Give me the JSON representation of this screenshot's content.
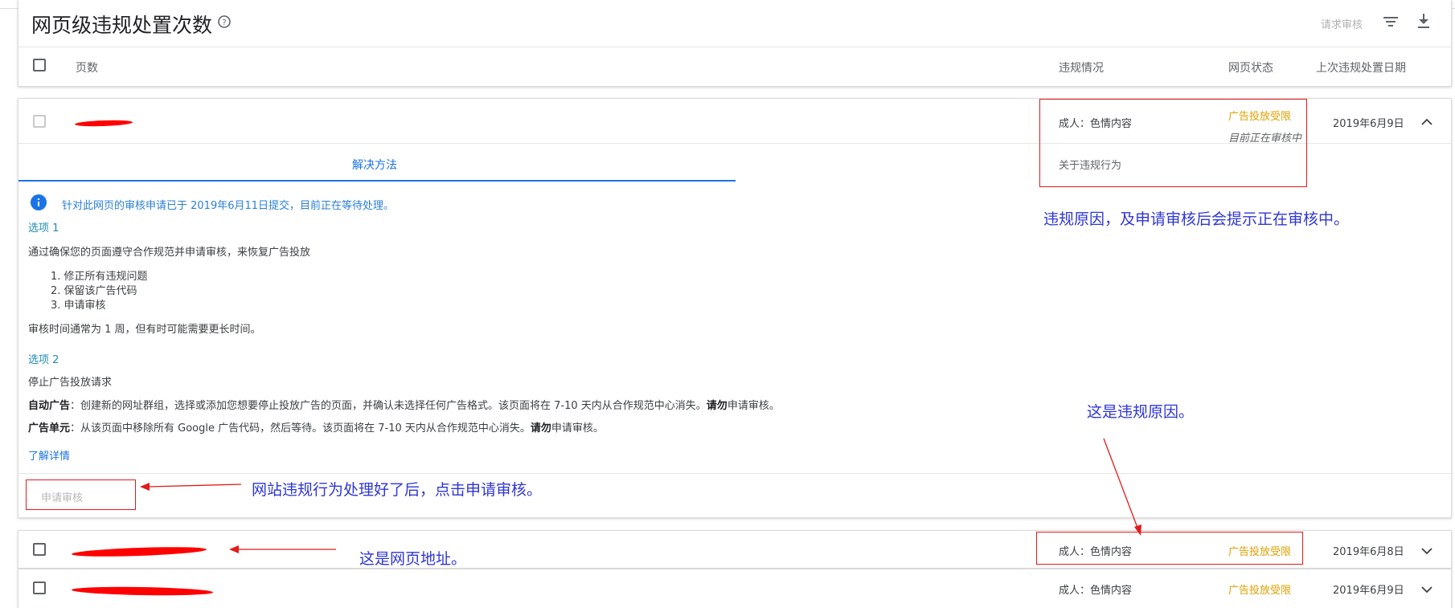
{
  "header": {
    "title": "网页级违规处置次数",
    "request_review": "请求审核",
    "col_pages": "页数",
    "col_violation": "违规情况",
    "col_status": "网页状态",
    "col_last_date": "上次违规处置日期"
  },
  "expanded_row": {
    "violation": "成人：色情内容",
    "status": "广告投放受限",
    "status_note": "目前正在审核中",
    "date": "2019年6月9日",
    "tab_solution": "解决方法",
    "tab_about": "关于违规行为",
    "info": "针对此网页的审核申请已于 2019年6月11日提交，目前正在等待处理。",
    "option1_title": "选项 1",
    "option1_desc": "通过确保您的页面遵守合作规范并申请审核，来恢复广告投放",
    "steps": [
      "1. 修正所有违规问题",
      "2. 保留该广告代码",
      "3. 申请审核"
    ],
    "review_time": "审核时间通常为 1 周，但有时可能需要更长时间。",
    "option2_title": "选项 2",
    "option2_desc": "停止广告投放请求",
    "auto_ads_label": "自动广告",
    "auto_ads_text": "：创建新的网址群组，选择或添加您想要停止投放广告的页面，并确认未选择任何广告格式。该页面将在 7-10 天内从合作规范中心消失。",
    "auto_ads_bold": "请勿",
    "auto_ads_tail": "申请审核。",
    "ad_units_label": "广告单元",
    "ad_units_text": "：从该页面中移除所有 Google 广告代码，然后等待。该页面将在 7-10 天内从合作规范中心消失。",
    "ad_units_bold": "请勿",
    "ad_units_tail": "申请审核。",
    "learn_more": "了解详情",
    "apply_button": "申请审核"
  },
  "rows": [
    {
      "violation": "成人：色情内容",
      "status": "广告投放受限",
      "date": "2019年6月8日"
    },
    {
      "violation": "成人：色情内容",
      "status": "广告投放受限",
      "date": "2019年6月9日"
    }
  ],
  "annotations": {
    "reason_review": "违规原因，及申请审核后会提示正在审核中。",
    "reason": "这是违规原因。",
    "apply_hint": "网站违规行为处理好了后，点击申请审核。",
    "url_hint": "这是网页地址。"
  },
  "colors": {
    "accent": "#1a73e8",
    "warning": "#e0a000",
    "annotation": "#2f36d4",
    "markup": "#e21b1b"
  },
  "icons": [
    "help-icon",
    "filter-icon",
    "download-icon",
    "chevron-up-icon",
    "chevron-down-icon",
    "info-icon"
  ]
}
